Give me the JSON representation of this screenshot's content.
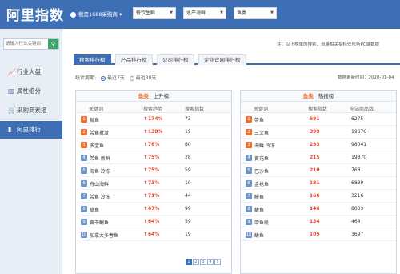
{
  "app": {
    "title": "阿里指数"
  },
  "header": {
    "user_label": "我是1688采购商",
    "selects": [
      "餐饮生鲜",
      "水产海鲜",
      "鱼类"
    ]
  },
  "sidebar": {
    "search_placeholder": "请输入行业关键词",
    "items": [
      {
        "label": "行业大盘",
        "icon": "chart-line-icon",
        "active": false
      },
      {
        "label": "属性细分",
        "icon": "bar-chart-icon",
        "active": false
      },
      {
        "label": "采购商素描",
        "icon": "cart-icon",
        "active": false
      },
      {
        "label": "阿里排行",
        "icon": "ranking-icon",
        "active": true
      }
    ]
  },
  "hint": "注：以下榜单的搜索、流量相关指标仅包括PC端数据",
  "tabs": [
    "搜索排行榜",
    "产品排行榜",
    "公司排行榜",
    "企业官网排行榜"
  ],
  "period": {
    "label": "统计周期:",
    "options": [
      "最近7天",
      "最近30天"
    ],
    "selected": "最近7天"
  },
  "update_time": "数据更新时间：2020-01-04",
  "left_panel": {
    "keyword": "鱼类",
    "title": "上升榜",
    "columns": [
      "关键词",
      "搜索趋势",
      "搜索指数"
    ],
    "rows": [
      {
        "rank": "1",
        "keyword": "鱿鱼",
        "trend": "174%",
        "index": "73"
      },
      {
        "rank": "2",
        "keyword": "带鱼批发",
        "trend": "138%",
        "index": "19"
      },
      {
        "rank": "3",
        "keyword": "多宝鱼",
        "trend": "76%",
        "index": "80"
      },
      {
        "rank": "4",
        "keyword": "带鱼 新鲜",
        "trend": "75%",
        "index": "28"
      },
      {
        "rank": "5",
        "keyword": "海鱼 冷冻",
        "trend": "75%",
        "index": "59"
      },
      {
        "rank": "6",
        "keyword": "舟山海鲜",
        "trend": "73%",
        "index": "10"
      },
      {
        "rank": "7",
        "keyword": "带鱼 冷冻",
        "trend": "71%",
        "index": "44"
      },
      {
        "rank": "8",
        "keyword": "草鱼",
        "trend": "67%",
        "index": "99"
      },
      {
        "rank": "9",
        "keyword": "黄干鲷鱼",
        "trend": "64%",
        "index": "59"
      },
      {
        "rank": "10",
        "keyword": "加拿大多春鱼",
        "trend": "64%",
        "index": "19"
      }
    ]
  },
  "right_panel": {
    "keyword": "鱼类",
    "title": "热搜榜",
    "columns": [
      "关键词",
      "搜索指数",
      "全站商品数"
    ],
    "rows": [
      {
        "rank": "1",
        "keyword": "带鱼",
        "index": "591",
        "count": "6275"
      },
      {
        "rank": "2",
        "keyword": "三文鱼",
        "index": "399",
        "count": "19676"
      },
      {
        "rank": "3",
        "keyword": "海鲜 冷冻",
        "index": "293",
        "count": "98041"
      },
      {
        "rank": "4",
        "keyword": "黄花鱼",
        "index": "215",
        "count": "19870"
      },
      {
        "rank": "5",
        "keyword": "巴沙鱼",
        "index": "210",
        "count": "768"
      },
      {
        "rank": "6",
        "keyword": "金枪鱼",
        "index": "181",
        "count": "6839"
      },
      {
        "rank": "7",
        "keyword": "鳗鱼",
        "index": "166",
        "count": "3216"
      },
      {
        "rank": "8",
        "keyword": "鲅鱼",
        "index": "140",
        "count": "8033"
      },
      {
        "rank": "9",
        "keyword": "带鱼段",
        "index": "134",
        "count": "464"
      },
      {
        "rank": "10",
        "keyword": "鲅鱼",
        "index": "105",
        "count": "3697"
      }
    ]
  },
  "pager": [
    "1",
    "2",
    "3",
    "4",
    "5"
  ],
  "colors": {
    "brand": "#3e6fb5",
    "accent": "#e8702a",
    "up": "#e8442a"
  }
}
